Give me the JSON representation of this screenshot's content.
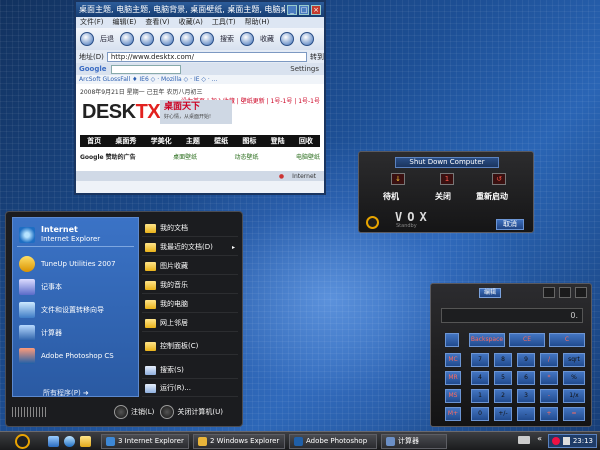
{
  "browser": {
    "title": "桌面主题, 电脑主题, 电脑背景, 桌面壁纸, 桌面主题, 电脑桌面",
    "menu": [
      "文件(F)",
      "编辑(E)",
      "查看(V)",
      "收藏(A)",
      "工具(T)",
      "帮助(H)"
    ],
    "toolbar": {
      "back": "后退",
      "favorites": "收藏",
      "search": "搜索"
    },
    "address": {
      "label": "地址(D)",
      "value": "http://www.desktx.com/",
      "go": "转到"
    },
    "google": {
      "label": "Google",
      "settings": "Settings"
    },
    "links": "ArcSoft  GLossFall  ♦  IE6 ◇ · Mozilla ◇ · IE ◇ · ...",
    "date_line": "2008年9月21日  星期一  己丑年  农历八月初三",
    "date_right": "设为首页 | 加入收藏 | 壁纸更新 | 1号-1号 | 1号-1号",
    "logo": {
      "desk": "DESK",
      "tx": "TX"
    },
    "badge": {
      "title": "桌面天下",
      "sub": "好心情，从桌面开始!"
    },
    "nav": [
      "首页",
      "桌面秀",
      "学美化",
      "主题",
      "壁纸",
      "图标",
      "登陆",
      "回收"
    ],
    "ads": [
      "Google 赞助的广告",
      "桌面壁纸",
      "动态壁纸",
      "电脑壁纸"
    ],
    "status": {
      "done": "",
      "zone": "Internet"
    }
  },
  "shutdown": {
    "title": "Shut Down Computer",
    "options": [
      {
        "led": "↓",
        "label": "待机"
      },
      {
        "led": "1",
        "label": "关闭"
      },
      {
        "led": "↺",
        "label": "重新启动"
      }
    ],
    "brand": "VOX",
    "brand_sub": "Standby",
    "cancel": "取消"
  },
  "start_menu": {
    "pinned": {
      "title": "Internet",
      "subtitle": "Internet Explorer"
    },
    "recent": [
      "TuneUp Utilities 2007",
      "记事本",
      "文件和设置转移向导",
      "计算器",
      "Adobe Photoshop CS"
    ],
    "all_programs": "所有程序(P)",
    "right": [
      {
        "label": "我的文档",
        "arrow": ""
      },
      {
        "label": "我最近的文档(D)",
        "arrow": "▸"
      },
      {
        "label": "图片收藏",
        "arrow": ""
      },
      {
        "label": "我的音乐",
        "arrow": ""
      },
      {
        "label": "我的电脑",
        "arrow": ""
      },
      {
        "label": "网上邻居",
        "arrow": ""
      },
      {
        "label": "控制面板(C)",
        "arrow": ""
      },
      {
        "label": "搜索(S)",
        "arrow": ""
      },
      {
        "label": "运行(R)...",
        "arrow": ""
      }
    ],
    "logoff": "注销(L)",
    "shutdown": "关闭计算机(U)"
  },
  "calculator": {
    "menu_edit": "编辑",
    "display": "0.",
    "top_row": [
      "Backspace",
      "CE",
      "C"
    ],
    "left_col": [
      "MC",
      "MR",
      "MS",
      "M+"
    ],
    "keys": [
      [
        "7",
        "8",
        "9",
        "/",
        "sqrt"
      ],
      [
        "4",
        "5",
        "6",
        "*",
        "%"
      ],
      [
        "1",
        "2",
        "3",
        "-",
        "1/x"
      ],
      [
        "0",
        "+/-",
        ".",
        "+",
        "="
      ]
    ]
  },
  "taskbar": {
    "tasks": [
      {
        "label": "3 Internet Explorer",
        "color": "#3d88d6"
      },
      {
        "label": "2 Windows Explorer",
        "color": "#e8b43a"
      },
      {
        "label": "Adobe Photoshop",
        "color": "#1f5fa8"
      },
      {
        "label": "计算器",
        "color": "#6b8fc6"
      }
    ],
    "clock": "23:13"
  }
}
